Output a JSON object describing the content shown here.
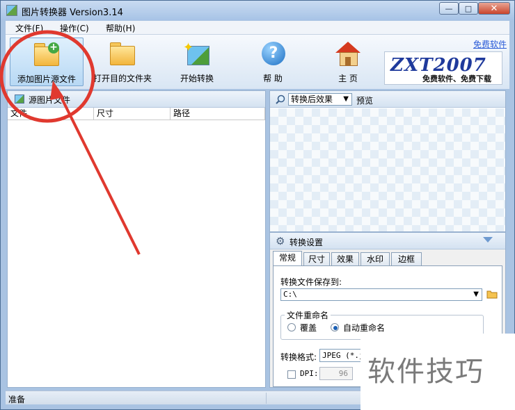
{
  "window": {
    "title": "图片转换器 Version3.14",
    "close_glyph": "✕",
    "min_glyph": "—",
    "max_glyph": "□"
  },
  "menu": {
    "items": [
      "文件(F)",
      "操作(C)",
      "帮助(H)"
    ]
  },
  "toolbar": {
    "add_source": "添加图片源文件",
    "open_folder": "打开目的文件夹",
    "start_convert": "开始转换",
    "help": "帮 助",
    "home": "主 页"
  },
  "logo": {
    "link_text": "免费软件",
    "main": "ZXT2007",
    "sub": "免费软件、免费下载"
  },
  "left_panel": {
    "title": "源图片文件",
    "columns": [
      "文件",
      "尺寸",
      "路径"
    ]
  },
  "preview": {
    "effect_select_value": "转换后效果",
    "label": "预览"
  },
  "settings": {
    "title": "转换设置",
    "tabs": [
      "常规",
      "尺寸",
      "效果",
      "水印",
      "边框"
    ],
    "active_tab": "常规",
    "save_to_label": "转换文件保存到:",
    "save_path": "C:\\",
    "rename_group_label": "文件重命名",
    "rename_options": [
      "覆盖",
      "自动重命名"
    ],
    "rename_selected": "自动重命名",
    "format_label": "转换格式:",
    "format_value": "JPEG (*.jpg)",
    "dpi_label": "DPI:",
    "dpi_value": "96"
  },
  "status": {
    "text": "准备"
  },
  "watermark": {
    "text": "软件技巧"
  },
  "colors": {
    "annotation_red": "#e0392f",
    "title_bar": "#b8cfea",
    "link_blue": "#2a5bd7",
    "logo_blue": "#1f3a9c"
  }
}
